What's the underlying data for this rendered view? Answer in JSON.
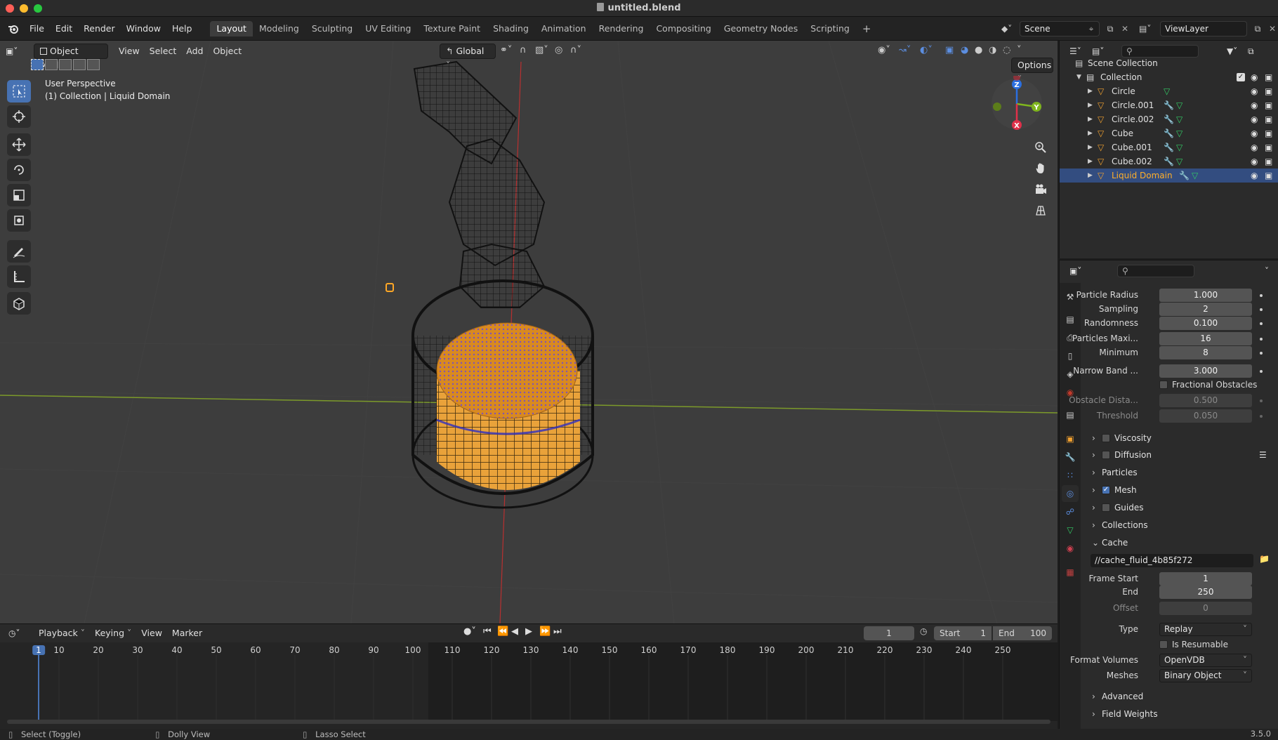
{
  "window": {
    "title": "untitled.blend"
  },
  "topbar": {
    "menus": [
      "File",
      "Edit",
      "Render",
      "Window",
      "Help"
    ],
    "workspaces": [
      "Layout",
      "Modeling",
      "Sculpting",
      "UV Editing",
      "Texture Paint",
      "Shading",
      "Animation",
      "Rendering",
      "Compositing",
      "Geometry Nodes",
      "Scripting"
    ],
    "active_workspace": "Layout",
    "scene": "Scene",
    "view_layer": "ViewLayer"
  },
  "viewport": {
    "mode": "Object Mode",
    "menus": [
      "View",
      "Select",
      "Add",
      "Object"
    ],
    "orientation": "Global",
    "options_label": "Options",
    "overlay_title": "User Perspective",
    "overlay_sub": "(1) Collection | Liquid Domain",
    "gizmo_axes": [
      "Z",
      "Y",
      "X"
    ]
  },
  "outliner": {
    "root": "Scene Collection",
    "collection": "Collection",
    "objects": [
      {
        "name": "Circle",
        "modifier": false,
        "selected": false
      },
      {
        "name": "Circle.001",
        "modifier": true,
        "selected": false
      },
      {
        "name": "Circle.002",
        "modifier": true,
        "selected": false
      },
      {
        "name": "Cube",
        "modifier": true,
        "selected": false
      },
      {
        "name": "Cube.001",
        "modifier": true,
        "selected": false
      },
      {
        "name": "Cube.002",
        "modifier": true,
        "selected": false
      },
      {
        "name": "Liquid Domain",
        "modifier": true,
        "selected": true
      }
    ]
  },
  "properties": {
    "fields": [
      {
        "label": "Particle Radius",
        "value": "1.000"
      },
      {
        "label": "Sampling",
        "value": "2"
      },
      {
        "label": "Randomness",
        "value": "0.100"
      },
      {
        "label": "Particles Maxi...",
        "value": "16"
      },
      {
        "label": "Minimum",
        "value": "8"
      },
      {
        "label": "Narrow Band ...",
        "value": "3.000"
      }
    ],
    "fractional_obstacles": "Fractional Obstacles",
    "obstacle_distance": {
      "label": "Obstacle Dista...",
      "value": "0.500"
    },
    "threshold": {
      "label": "Threshold",
      "value": "0.050"
    },
    "panels": {
      "viscosity": "Viscosity",
      "diffusion": "Diffusion",
      "particles": "Particles",
      "mesh": "Mesh",
      "guides": "Guides",
      "collections": "Collections",
      "cache": "Cache",
      "advanced": "Advanced",
      "field_weights": "Field Weights"
    },
    "cache_path": "//cache_fluid_4b85f272",
    "frame_start": {
      "label": "Frame Start",
      "value": "1"
    },
    "end": {
      "label": "End",
      "value": "250"
    },
    "offset": {
      "label": "Offset",
      "value": "0"
    },
    "type": {
      "label": "Type",
      "value": "Replay"
    },
    "is_resumable": "Is Resumable",
    "format_volumes": {
      "label": "Format Volumes",
      "value": "OpenVDB"
    },
    "meshes": {
      "label": "Meshes",
      "value": "Binary Object"
    }
  },
  "timeline": {
    "menus": [
      "Playback",
      "Keying",
      "View",
      "Marker"
    ],
    "current_frame": "1",
    "start_label": "Start",
    "start_value": "1",
    "end_label": "End",
    "end_value": "100",
    "ruler": [
      "1",
      "10",
      "20",
      "30",
      "40",
      "50",
      "60",
      "70",
      "80",
      "90",
      "100",
      "110",
      "120",
      "130",
      "140",
      "150",
      "160",
      "170",
      "180",
      "190",
      "200",
      "210",
      "220",
      "230",
      "240",
      "250"
    ]
  },
  "statusbar": {
    "select": "Select (Toggle)",
    "dolly": "Dolly View",
    "lasso": "Lasso Select",
    "version": "3.5.0"
  }
}
